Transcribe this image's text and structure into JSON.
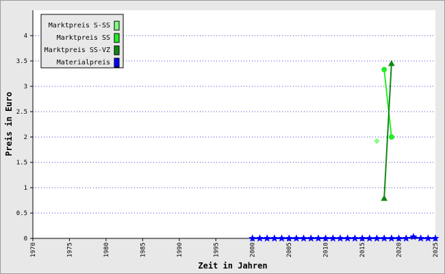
{
  "chart_data": {
    "type": "line",
    "title": "",
    "xlabel": "Zeit in Jahren",
    "ylabel": "Preis in Euro",
    "xlim": [
      1970,
      2025
    ],
    "ylim": [
      0,
      4.5
    ],
    "x_ticks": [
      "1970",
      "1975",
      "1980",
      "1985",
      "1990",
      "1995",
      "2000",
      "2005",
      "2010",
      "2015",
      "2020",
      "2025"
    ],
    "y_ticks": [
      "0",
      "0.5",
      "1",
      "1.5",
      "2",
      "2.5",
      "3",
      "3.5",
      "4"
    ],
    "grid": "horizontal dotted",
    "legend_position": "top-left",
    "series": [
      {
        "name": "Marktpreis S-SS",
        "color": "#80ff80",
        "marker": "diamond",
        "points": [
          [
            2017,
            1.92
          ]
        ]
      },
      {
        "name": "Marktpreis SS",
        "color": "#22ee22",
        "marker": "circle",
        "points": [
          [
            2018,
            3.33
          ],
          [
            2019,
            2.0
          ]
        ]
      },
      {
        "name": "Marktpreis SS-VZ",
        "color": "#108810",
        "marker": "triangle",
        "points": [
          [
            2018,
            0.79
          ],
          [
            2019,
            3.45
          ]
        ]
      },
      {
        "name": "Materialpreis",
        "color": "#0000ff",
        "marker": "star",
        "points": [
          [
            2000,
            0
          ],
          [
            2001,
            0
          ],
          [
            2002,
            0
          ],
          [
            2003,
            0
          ],
          [
            2004,
            0
          ],
          [
            2005,
            0
          ],
          [
            2006,
            0
          ],
          [
            2007,
            0
          ],
          [
            2008,
            0
          ],
          [
            2009,
            0
          ],
          [
            2010,
            0
          ],
          [
            2011,
            0
          ],
          [
            2012,
            0
          ],
          [
            2013,
            0
          ],
          [
            2014,
            0
          ],
          [
            2015,
            0
          ],
          [
            2016,
            0
          ],
          [
            2017,
            0
          ],
          [
            2018,
            0
          ],
          [
            2019,
            0
          ],
          [
            2020,
            0
          ],
          [
            2021,
            0
          ],
          [
            2022,
            0.03
          ],
          [
            2023,
            0
          ],
          [
            2024,
            0
          ],
          [
            2025,
            0
          ]
        ]
      }
    ]
  }
}
